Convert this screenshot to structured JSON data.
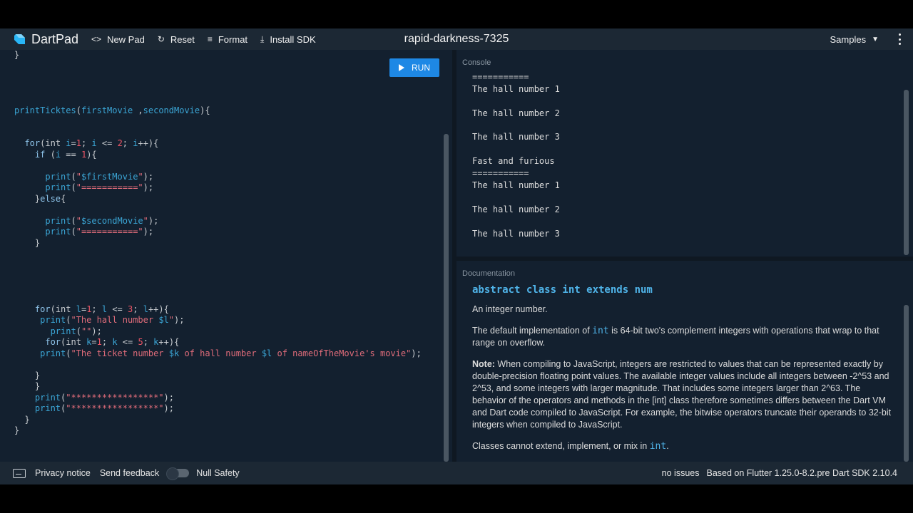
{
  "header": {
    "brand": "DartPad",
    "new_pad": "New Pad",
    "reset": "Reset",
    "format": "Format",
    "install_sdk": "Install SDK",
    "title": "rapid-darkness-7325",
    "samples": "Samples"
  },
  "editor": {
    "run_label": "RUN"
  },
  "console": {
    "label": "Console",
    "lines": [
      "===========",
      "The hall number 1",
      "",
      "The hall number 2",
      "",
      "The hall number 3",
      "",
      "Fast and furious",
      "===========",
      "The hall number 1",
      "",
      "The hall number 2",
      "",
      "The hall number 3"
    ]
  },
  "docs": {
    "label": "Documentation",
    "heading": "abstract class int extends num",
    "p1": "An integer number.",
    "p2_pre": "The default implementation of ",
    "p2_code": "int",
    "p2_post": " is 64-bit two's complement integers with operations that wrap to that range on overflow.",
    "note_label": "Note:",
    "note_text": " When compiling to JavaScript, integers are restricted to values that can be represented exactly by double-precision floating point values. The available integer values include all integers between -2^53 and 2^53, and some integers with larger magnitude. That includes some integers larger than 2^63. The behavior of the operators and methods in the [int] class therefore sometimes differs between the Dart VM and Dart code compiled to JavaScript. For example, the bitwise operators truncate their operands to 32-bit integers when compiled to JavaScript.",
    "p4_pre": "Classes cannot extend, implement, or mix in ",
    "p4_code": "int",
    "p4_post": "."
  },
  "footer": {
    "privacy": "Privacy notice",
    "feedback": "Send feedback",
    "null_safety": "Null Safety",
    "null_safety_enabled": false,
    "issues": "no issues",
    "sdk": "Based on Flutter 1.25.0-8.2.pre Dart SDK 2.10.4"
  },
  "colors": {
    "background": "#13202f",
    "bar": "#1c2834",
    "run_button": "#1e88e5",
    "doc_link": "#4fb3e8"
  },
  "icons": [
    "dart-logo-icon",
    "code-icon",
    "refresh-icon",
    "format-align-icon",
    "download-icon",
    "chevron-down-icon",
    "more-vert-icon",
    "keyboard-icon",
    "play-icon"
  ]
}
